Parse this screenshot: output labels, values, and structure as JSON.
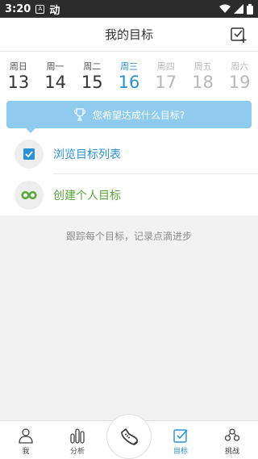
{
  "status_bar": {
    "time": "3:20",
    "app_glyph": "动"
  },
  "header": {
    "title": "我的目标"
  },
  "week": [
    {
      "name": "周日",
      "num": "13",
      "state": "past"
    },
    {
      "name": "周一",
      "num": "14",
      "state": "past"
    },
    {
      "name": "周二",
      "num": "15",
      "state": "past"
    },
    {
      "name": "周三",
      "num": "16",
      "state": "active"
    },
    {
      "name": "周四",
      "num": "17",
      "state": "future"
    },
    {
      "name": "周五",
      "num": "18",
      "state": "future"
    },
    {
      "name": "周六",
      "num": "19",
      "state": "future"
    }
  ],
  "prompt": {
    "text": "您希望达成什么目标?"
  },
  "actions": {
    "browse": {
      "label": "浏览目标列表",
      "icon": "checkbox-icon"
    },
    "create": {
      "label": "创建个人目标",
      "icon": "infinity-icon"
    }
  },
  "hint": "跟踪每个目标，记录点滴进步",
  "tabbar": {
    "me": "我",
    "analysis": "分析",
    "goals": "目标",
    "challenge": "挑战"
  },
  "colors": {
    "accent": "#2a92d6",
    "green": "#5aa83c",
    "prompt_bg": "#8ecbef"
  }
}
